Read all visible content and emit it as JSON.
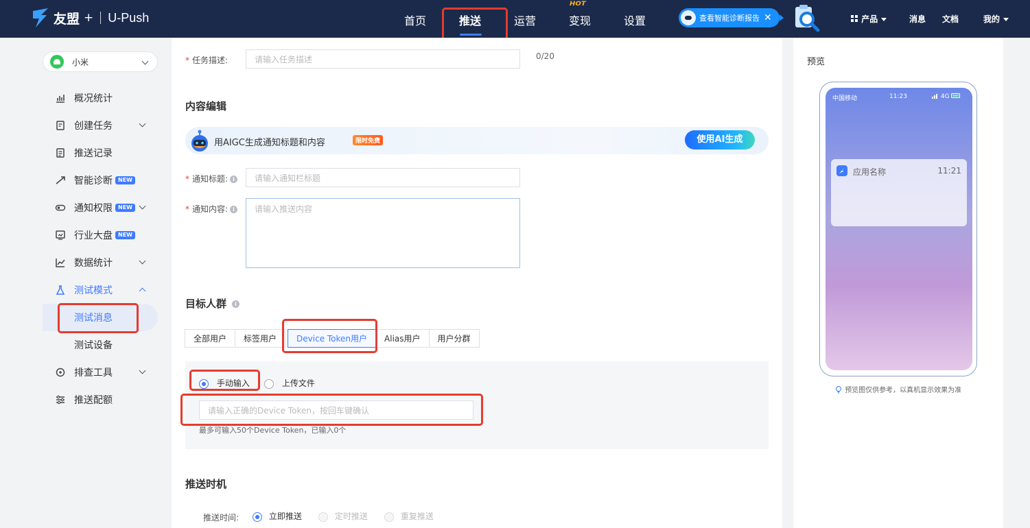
{
  "topbar": {
    "brand": "友盟",
    "plus": "+",
    "product": "U-Push",
    "nav": [
      "首页",
      "推送",
      "运营",
      "变现",
      "设置"
    ],
    "active_nav": "推送",
    "hot_badge": "HOT",
    "diag_pill": "查看智能诊断报告",
    "close_glyph": "✕",
    "right": {
      "products": "产品",
      "messages": "消息",
      "docs": "文档",
      "mine": "我的"
    }
  },
  "sidebar": {
    "platform": "小米",
    "items": [
      {
        "label": "概况统计",
        "icon": "chart-icon"
      },
      {
        "label": "创建任务",
        "icon": "task-icon",
        "expandable": true
      },
      {
        "label": "推送记录",
        "icon": "record-icon"
      },
      {
        "label": "智能诊断",
        "icon": "diagnose-icon",
        "badge": "NEW"
      },
      {
        "label": "通知权限",
        "icon": "toggle-icon",
        "badge": "NEW",
        "expandable": true
      },
      {
        "label": "行业大盘",
        "icon": "dashboard-icon",
        "badge": "NEW"
      },
      {
        "label": "数据统计",
        "icon": "stats-icon",
        "expandable": true
      },
      {
        "label": "测试模式",
        "icon": "flask-icon",
        "expanded": true
      },
      {
        "label": "测试消息",
        "sub": true,
        "active": true
      },
      {
        "label": "测试设备",
        "sub": true
      },
      {
        "label": "排查工具",
        "icon": "tool-icon",
        "expandable": true
      },
      {
        "label": "推送配额",
        "icon": "quota-icon"
      }
    ]
  },
  "form": {
    "task_desc_label": "任务描述:",
    "task_desc_placeholder": "请输入任务描述",
    "task_desc_counter": "0/20",
    "content_section": "内容编辑",
    "aigc_text": "用AIGC生成通知标题和内容",
    "aigc_badge": "限时免费",
    "aigc_button": "使用AI生成",
    "title_label": "通知标题:",
    "title_placeholder": "请输入通知栏标题",
    "content_label": "通知内容:",
    "content_placeholder": "请输入推送内容",
    "target_section": "目标人群",
    "tabs": [
      "全部用户",
      "标签用户",
      "Device Token用户",
      "Alias用户",
      "用户分群"
    ],
    "active_tab": "Device Token用户",
    "input_modes": [
      "手动输入",
      "上传文件"
    ],
    "token_placeholder": "请输入正确的Device Token，按回车键确认",
    "token_hint": "最多可输入50个Device Token，已输入0个",
    "timing_section": "推送时机",
    "timing_label": "推送时间:",
    "timing_options": [
      "立即推送",
      "定时推送",
      "重复推送"
    ]
  },
  "preview": {
    "title": "预览",
    "carrier": "中国移动",
    "time": "11:23",
    "network": "4G",
    "app_name": "应用名称",
    "notif_time": "11:21",
    "note": "预览图仅供参考，以真机显示效果为准"
  },
  "colors": {
    "topbar": "#1b2a4a",
    "accent": "#3f7bff",
    "highlight": "#e53b2f"
  }
}
